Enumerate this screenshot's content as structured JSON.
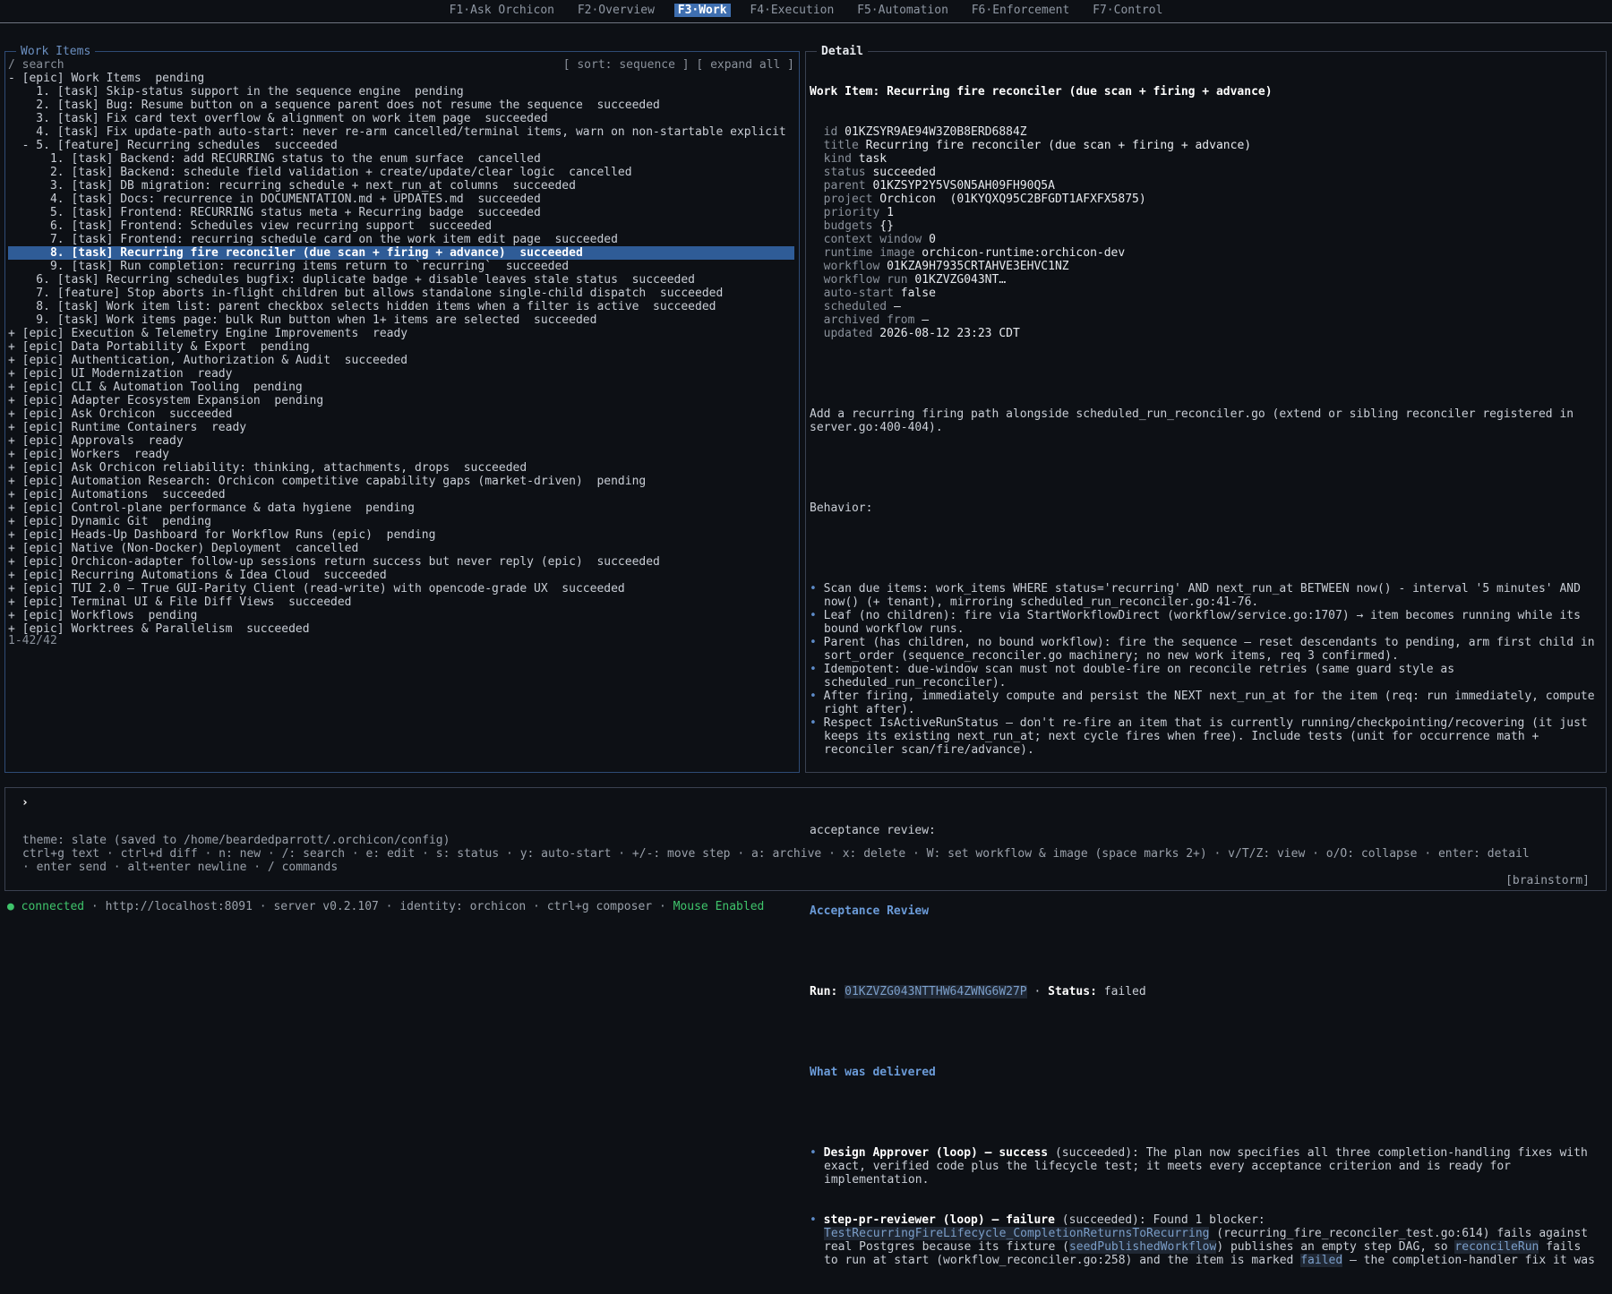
{
  "tabs": [
    {
      "key": "F1",
      "label": "Ask Orchicon"
    },
    {
      "key": "F2",
      "label": "Overview"
    },
    {
      "key": "F3",
      "label": "Work"
    },
    {
      "key": "F4",
      "label": "Execution"
    },
    {
      "key": "F5",
      "label": "Automation"
    },
    {
      "key": "F6",
      "label": "Enforcement"
    },
    {
      "key": "F7",
      "label": "Control"
    }
  ],
  "work": {
    "title": "Work Items",
    "search_label": "/ search",
    "sort_label": "[ sort: sequence ]",
    "expand_label": "[ expand all ]",
    "count": "1-42/42",
    "selected_index": 13,
    "rows": [
      "- [epic] Work Items  pending",
      "    1. [task] Skip-status support in the sequence engine  pending",
      "    2. [task] Bug: Resume button on a sequence parent does not resume the sequence  succeeded",
      "    3. [task] Fix card text overflow & alignment on work item page  succeeded",
      "    4. [task] Fix update-path auto-start: never re-arm cancelled/terminal items, warn on non-startable explicit",
      "  - 5. [feature] Recurring schedules  succeeded",
      "      1. [task] Backend: add RECURRING status to the enum surface  cancelled",
      "      2. [task] Backend: schedule field validation + create/update/clear logic  cancelled",
      "      3. [task] DB migration: recurring schedule + next_run_at columns  succeeded",
      "      4. [task] Docs: recurrence in DOCUMENTATION.md + UPDATES.md  succeeded",
      "      5. [task] Frontend: RECURRING status meta + Recurring badge  succeeded",
      "      6. [task] Frontend: Schedules view recurring support  succeeded",
      "      7. [task] Frontend: recurring schedule card on the work item edit page  succeeded",
      "      8. [task] Recurring fire reconciler (due scan + firing + advance)  succeeded",
      "      9. [task] Run completion: recurring items return to `recurring`  succeeded",
      "    6. [task] Recurring schedules bugfix: duplicate badge + disable leaves stale status  succeeded",
      "    7. [feature] Stop aborts in-flight children but allows standalone single-child dispatch  succeeded",
      "    8. [task] Work item list: parent checkbox selects hidden items when a filter is active  succeeded",
      "    9. [task] Work items page: bulk Run button when 1+ items are selected  succeeded",
      "+ [epic] Execution & Telemetry Engine Improvements  ready",
      "+ [epic] Data Portability & Export  pending",
      "+ [epic] Authentication, Authorization & Audit  succeeded",
      "+ [epic] UI Modernization  ready",
      "+ [epic] CLI & Automation Tooling  pending",
      "+ [epic] Adapter Ecosystem Expansion  pending",
      "+ [epic] Ask Orchicon  succeeded",
      "+ [epic] Runtime Containers  ready",
      "+ [epic] Approvals  ready",
      "+ [epic] Workers  ready",
      "+ [epic] Ask Orchicon reliability: thinking, attachments, drops  succeeded",
      "+ [epic] Automation Research: Orchicon competitive capability gaps (market-driven)  pending",
      "+ [epic] Automations  succeeded",
      "+ [epic] Control-plane performance & data hygiene  pending",
      "+ [epic] Dynamic Git  pending",
      "+ [epic] Heads-Up Dashboard for Workflow Runs (epic)  pending",
      "+ [epic] Native (Non-Docker) Deployment  cancelled",
      "+ [epic] Orchicon-adapter follow-up sessions return success but never reply (epic)  succeeded",
      "+ [epic] Recurring Automations & Idea Cloud  succeeded",
      "+ [epic] TUI 2.0 — True GUI-Parity Client (read-write) with opencode-grade UX  succeeded",
      "+ [epic] Terminal UI & File Diff Views  succeeded",
      "+ [epic] Workflows  pending",
      "+ [epic] Worktrees & Parallelism  succeeded"
    ]
  },
  "detail": {
    "panel_title": "Detail",
    "heading": "Work Item: Recurring fire reconciler (due scan + firing + advance)",
    "fields": [
      {
        "key": "id",
        "value": "01KZSYR9AE94W3Z0B8ERD6884Z"
      },
      {
        "key": "title",
        "value": "Recurring fire reconciler (due scan + firing + advance)"
      },
      {
        "key": "kind",
        "value": "task"
      },
      {
        "key": "status",
        "value": "succeeded"
      },
      {
        "key": "parent",
        "value": "01KZSYP2Y5VS0N5AH09FH90Q5A"
      },
      {
        "key": "project",
        "value": "Orchicon  (01KYQXQ95C2BFGDT1AFXFX5875)"
      },
      {
        "key": "priority",
        "value": "1"
      },
      {
        "key": "budgets",
        "value": "{}"
      },
      {
        "key": "context window",
        "value": "0"
      },
      {
        "key": "runtime image",
        "value": "orchicon-runtime:orchicon-dev"
      },
      {
        "key": "workflow",
        "value": "01KZA9H7935CRTAHVE3EHVC1NZ"
      },
      {
        "key": "workflow run",
        "value": "01KZVZG043NT…"
      },
      {
        "key": "auto-start",
        "value": "false"
      },
      {
        "key": "scheduled",
        "value": "–"
      },
      {
        "key": "archived from",
        "value": "–"
      },
      {
        "key": "updated",
        "value": "2026-08-12 23:23 CDT"
      }
    ],
    "intro": "Add a recurring firing path alongside scheduled_run_reconciler.go (extend or sibling reconciler registered in server.go:400-404).",
    "behavior_label": "Behavior:",
    "bullets": [
      "Scan due items: work_items WHERE status='recurring' AND next_run_at BETWEEN now() - interval '5 minutes' AND now() (+ tenant), mirroring scheduled_run_reconciler.go:41-76.",
      "Leaf (no children): fire via StartWorkflowDirect (workflow/service.go:1707) → item becomes running while its bound workflow runs.",
      "Parent (has children, no bound workflow): fire the sequence — reset descendants to pending, arm first child in sort_order (sequence_reconciler.go machinery; no new work items, req 3 confirmed).",
      "Idempotent: due-window scan must not double-fire on reconcile retries (same guard style as scheduled_run_reconciler).",
      "After firing, immediately compute and persist the NEXT next_run_at for the item (req: run immediately, compute right after).",
      "Respect IsActiveRunStatus — don't re-fire an item that is currently running/checkpointing/recovering (it just keeps its existing next_run_at; next cycle fires when free). Include tests (unit for occurrence math + reconciler scan/fire/advance)."
    ],
    "acceptance_label": "acceptance review:",
    "review_heading": "Acceptance Review",
    "run_label": "Run:",
    "run_id": "01KZVZG043NTTHW64ZWNG6W27P",
    "status_label": "Status:",
    "status_value": "failed",
    "delivered_heading": "What was delivered",
    "delivered": [
      {
        "name": "Design Approver (loop) — success",
        "state": "(succeeded):",
        "text": "The plan now specifies all three completion-handling fixes with exact, verified code plus the lifecycle test; it meets every acceptance criterion and is ready for implementation."
      },
      {
        "name": "step-pr-reviewer (loop) — failure",
        "state": "(succeeded):",
        "text_before": "Found 1 blocker:",
        "code1": "TestRecurringFireLifecycle_CompletionReturnsToRecurring",
        "text_mid1": "(recurring_fire_reconciler_test.go:614) fails against real Postgres because its fixture (",
        "code2": "seedPublishedWorkflow",
        "text_mid2": ") publishes an empty step DAG, so",
        "code3": "reconcileRun",
        "text_mid3": "fails to run at start (workflow_reconciler.go:258) and the item is marked",
        "code4": "failed",
        "text_end": "— the completion-handler fix it was"
      }
    ]
  },
  "composer": {
    "prompt": "›",
    "theme_line": "theme: slate (saved to /home/beardedparrott/.orchicon/config)",
    "keys_line1": "ctrl+g text · ctrl+d diff · n: new · /: search · e: edit · s: status · y: auto-start · +/-: move step · a: archive · x: delete · W: set workflow & image (space marks 2+) · v/T/Z: view · o/O: collapse · enter: detail",
    "keys_line2": "· enter send · alt+enter newline · / commands",
    "mode": "[brainstorm]"
  },
  "status": {
    "dot": "●",
    "connected": "connected",
    "url": "http://localhost:8091",
    "server": "server v0.2.107",
    "identity": "identity: orchicon",
    "composer": "ctrl+g composer",
    "mouse": "Mouse Enabled"
  },
  "colors": {
    "background": "#0d1015",
    "accent": "#3f6fb0",
    "selection": "#2f5c97",
    "ok": "#3fc46b"
  }
}
